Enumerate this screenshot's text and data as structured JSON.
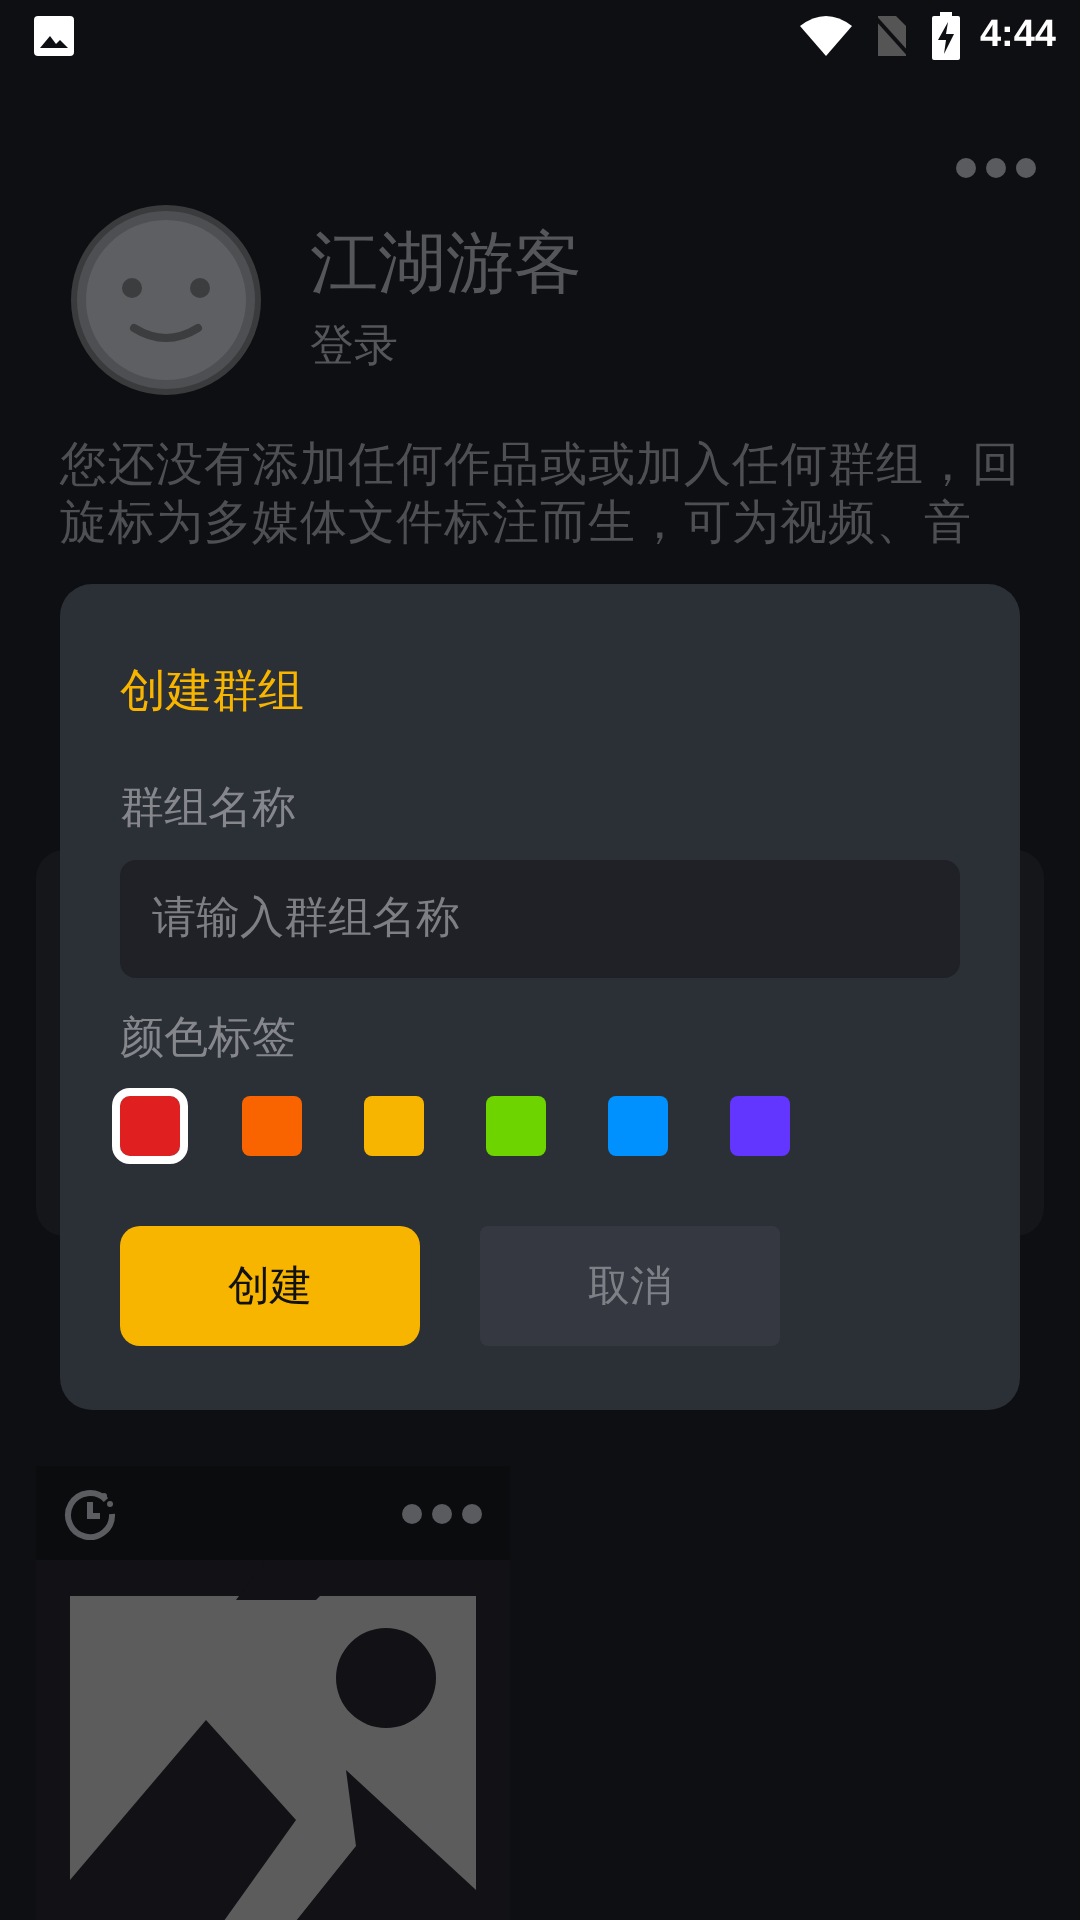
{
  "status_bar": {
    "time": "4:44"
  },
  "profile": {
    "name": "江湖游客",
    "login": "登录",
    "description": "您还没有添加任何作品或或加入任何群组，回旋标为多媒体文件标注而生，可为视频、音"
  },
  "dialog": {
    "title": "创建群组",
    "name_label": "群组名称",
    "name_field": {
      "placeholder": "请输入群组名称"
    },
    "color_label": "颜色标签",
    "colors": [
      {
        "color": "#e02020",
        "selected": true
      },
      {
        "color": "#fa6400",
        "selected": false
      },
      {
        "color": "#f7b500",
        "selected": false
      },
      {
        "color": "#6dd400",
        "selected": false
      },
      {
        "color": "#0091ff",
        "selected": false
      },
      {
        "color": "#6236ff",
        "selected": false
      }
    ],
    "buttons": [
      {
        "kind": "primary",
        "label": "创建"
      },
      {
        "kind": "secondary",
        "label": "取消"
      }
    ]
  }
}
